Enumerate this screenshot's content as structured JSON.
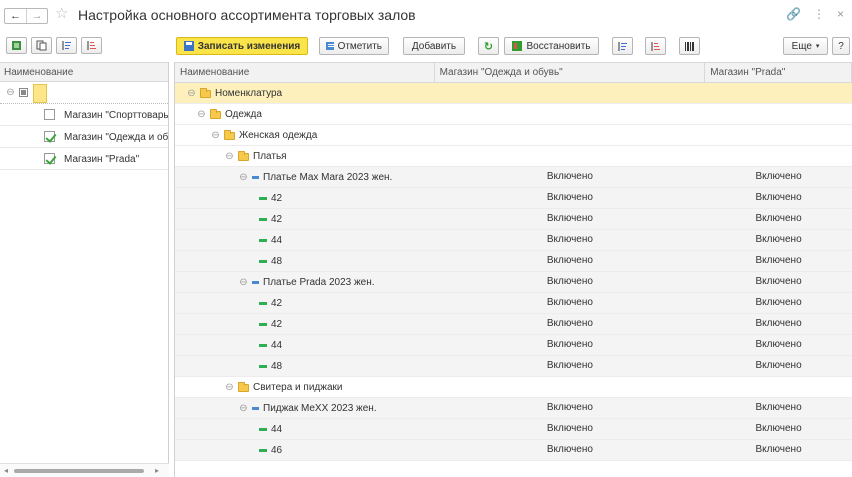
{
  "window": {
    "title": "Настройка основного ассортимента торговых залов"
  },
  "toolbar": {
    "save_label": "Записать изменения",
    "mark_label": "Отметить",
    "add_label": "Добавить",
    "restore_label": "Восстановить",
    "more_label": "Еще",
    "help_label": "?"
  },
  "left_pane": {
    "header": "Наименование",
    "items": [
      {
        "label": "",
        "checked": false
      },
      {
        "label": "Магазин \"Спорттовары\"",
        "checked": false
      },
      {
        "label": "Магазин \"Одежда и об...",
        "checked": true
      },
      {
        "label": "Магазин \"Prada\"",
        "checked": true
      }
    ]
  },
  "grid": {
    "columns": [
      "Наименование",
      "Магазин \"Одежда и обувь\"",
      "Магазин \"Prada\""
    ],
    "rows": [
      {
        "name": "Номенклатура",
        "kind": "folder",
        "level": 0,
        "v1": "",
        "v2": ""
      },
      {
        "name": "Одежда",
        "kind": "folder",
        "level": 1,
        "v1": "",
        "v2": ""
      },
      {
        "name": "Женская одежда",
        "kind": "folder",
        "level": 2,
        "v1": "",
        "v2": ""
      },
      {
        "name": "Платья",
        "kind": "folder",
        "level": 3,
        "v1": "",
        "v2": ""
      },
      {
        "name": "Платье Max Mara 2023 жен.",
        "kind": "item",
        "level": 4,
        "v1": "Включено",
        "v2": "Включено"
      },
      {
        "name": "42",
        "kind": "size",
        "level": 5,
        "v1": "Включено",
        "v2": "Включено"
      },
      {
        "name": "42",
        "kind": "size",
        "level": 5,
        "v1": "Включено",
        "v2": "Включено"
      },
      {
        "name": "44",
        "kind": "size",
        "level": 5,
        "v1": "Включено",
        "v2": "Включено"
      },
      {
        "name": "48",
        "kind": "size",
        "level": 5,
        "v1": "Включено",
        "v2": "Включено"
      },
      {
        "name": "Платье Prada 2023 жен.",
        "kind": "item",
        "level": 4,
        "v1": "Включено",
        "v2": "Включено"
      },
      {
        "name": "42",
        "kind": "size",
        "level": 5,
        "v1": "Включено",
        "v2": "Включено"
      },
      {
        "name": "42",
        "kind": "size",
        "level": 5,
        "v1": "Включено",
        "v2": "Включено"
      },
      {
        "name": "44",
        "kind": "size",
        "level": 5,
        "v1": "Включено",
        "v2": "Включено"
      },
      {
        "name": "48",
        "kind": "size",
        "level": 5,
        "v1": "Включено",
        "v2": "Включено"
      },
      {
        "name": "Свитера и пиджаки",
        "kind": "folder",
        "level": 3,
        "v1": "",
        "v2": ""
      },
      {
        "name": "Пиджак MeXX 2023 жен.",
        "kind": "item",
        "level": 4,
        "v1": "Включено",
        "v2": "Включено"
      },
      {
        "name": "44",
        "kind": "size",
        "level": 5,
        "v1": "Включено",
        "v2": "Включено"
      },
      {
        "name": "46",
        "kind": "size",
        "level": 5,
        "v1": "Включено",
        "v2": "Включено"
      }
    ]
  }
}
